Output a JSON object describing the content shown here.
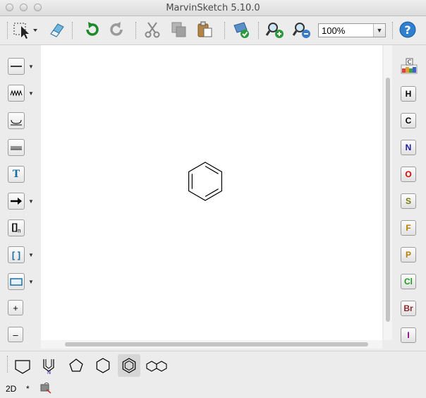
{
  "window": {
    "title": "MarvinSketch 5.10.0"
  },
  "toolbar": {
    "items": [
      {
        "name": "select-icon"
      },
      {
        "name": "eraser-icon"
      },
      {
        "name": "undo-icon"
      },
      {
        "name": "redo-icon"
      },
      {
        "name": "cut-icon"
      },
      {
        "name": "copy-icon"
      },
      {
        "name": "paste-icon"
      },
      {
        "name": "clean-structure-icon"
      },
      {
        "name": "zoom-in-icon"
      },
      {
        "name": "zoom-out-icon"
      },
      {
        "name": "help-icon"
      }
    ],
    "zoom_value": "100%"
  },
  "left_tools": [
    {
      "name": "single-bond-icon"
    },
    {
      "name": "any-bond-icon"
    },
    {
      "name": "chain-icon"
    },
    {
      "name": "ruler-icon"
    },
    {
      "name": "text-tool-icon",
      "label": "T"
    },
    {
      "name": "arrow-icon"
    },
    {
      "name": "sgroup-bracket-icon",
      "label": "[]",
      "sub": "n"
    },
    {
      "name": "bracket-icon",
      "label": "[ ]"
    },
    {
      "name": "rectangle-icon"
    },
    {
      "name": "charge-plus-icon",
      "label": "+"
    },
    {
      "name": "charge-minus-icon",
      "label": "–"
    }
  ],
  "elements": [
    {
      "symbol": "H",
      "color": "#000000"
    },
    {
      "symbol": "C",
      "color": "#000000"
    },
    {
      "symbol": "N",
      "color": "#1a1aa8"
    },
    {
      "symbol": "O",
      "color": "#e00000"
    },
    {
      "symbol": "S",
      "color": "#7a7a10"
    },
    {
      "symbol": "F",
      "color": "#b87f00"
    },
    {
      "symbol": "P",
      "color": "#b87f00"
    },
    {
      "symbol": "Cl",
      "color": "#1f9a1f"
    },
    {
      "symbol": "Br",
      "color": "#8a2a2a"
    },
    {
      "symbol": "I",
      "color": "#800080"
    }
  ],
  "periodic_table_label": "C",
  "templates": [
    {
      "name": "cyclopropane-template-icon"
    },
    {
      "name": "pyrrole-template-icon",
      "label": "N"
    },
    {
      "name": "cyclopentane-template-icon"
    },
    {
      "name": "cyclohexane-template-icon"
    },
    {
      "name": "benzene-template-icon",
      "selected": true
    },
    {
      "name": "naphthalene-template-icon"
    }
  ],
  "canvas": {
    "molecule": "benzene"
  },
  "status": {
    "mode": "2D",
    "modified": "*"
  }
}
